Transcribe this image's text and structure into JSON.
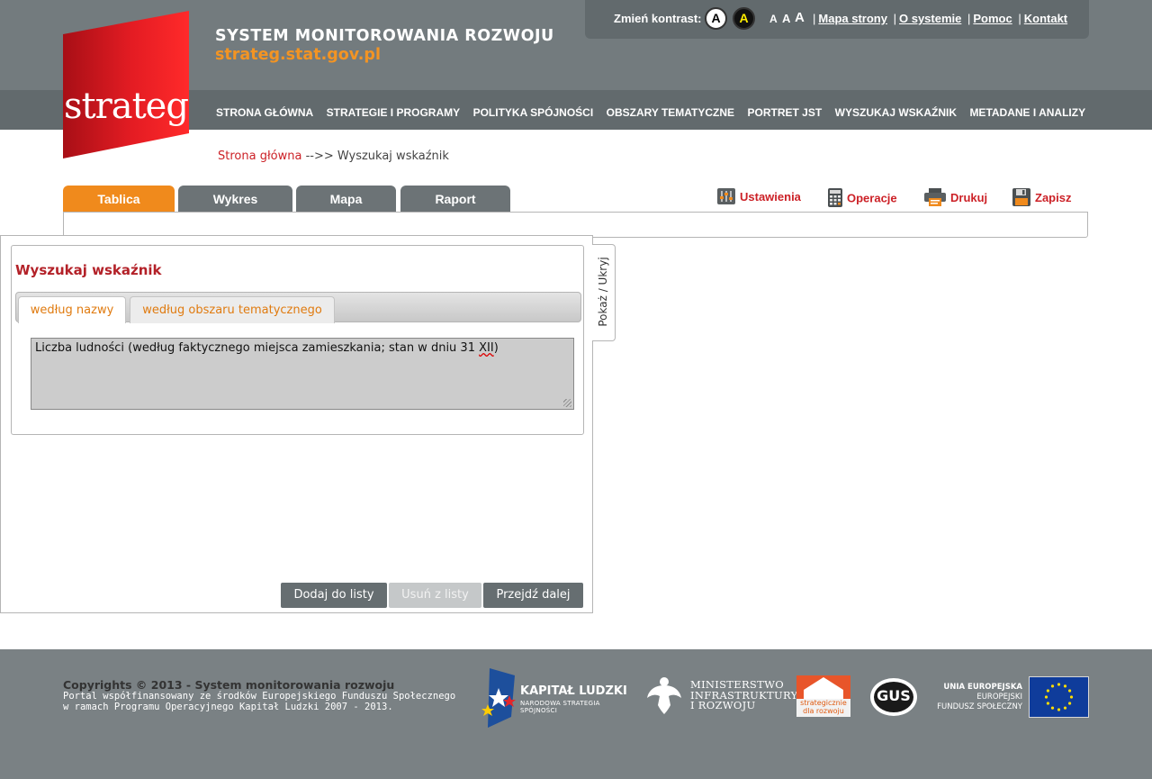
{
  "header": {
    "logo_text": "strateg",
    "title": "SYSTEM MONITOROWANIA ROZWOJU",
    "url": "strateg.stat.gov.pl"
  },
  "toolbar": {
    "contrast_label": "Zmień kontrast:",
    "contrast_options": [
      "A",
      "A"
    ],
    "font_sizes": [
      "A",
      "A",
      "A"
    ],
    "links": [
      "Mapa strony",
      "O systemie",
      "Pomoc",
      "Kontakt"
    ]
  },
  "nav": {
    "items": [
      "STRONA GŁÓWNA",
      "STRATEGIE I PROGRAMY",
      "POLITYKA SPÓJNOŚCI",
      "OBSZARY TEMATYCZNE",
      "PORTRET JST",
      "WYSZUKAJ WSKAŹNIK",
      "METADANE I ANALIZY"
    ]
  },
  "breadcrumb": {
    "home": "Strona główna",
    "separator": "-->>",
    "current": "Wyszukaj wskaźnik"
  },
  "tabs": [
    {
      "label": "Tablica",
      "active": true
    },
    {
      "label": "Wykres",
      "active": false
    },
    {
      "label": "Mapa",
      "active": false
    },
    {
      "label": "Raport",
      "active": false
    }
  ],
  "tools": {
    "settings": "Ustawienia",
    "operations": "Operacje",
    "print": "Drukuj",
    "save": "Zapisz"
  },
  "search": {
    "title": "Wyszukaj wskaźnik",
    "subtabs": [
      "według nazwy",
      "według obszaru tematycznego"
    ],
    "active_subtab": "według nazwy",
    "query_prefix": "Liczba ludności (według faktycznego miejsca zamieszkania; stan w dniu 31 ",
    "query_spell": "XII",
    "query_suffix": ")",
    "toggle_label": "Pokaż / Ukryj"
  },
  "buttons": {
    "add": "Dodaj do listy",
    "remove": "Usuń z listy",
    "next": "Przejdź dalej"
  },
  "footer": {
    "copyright": "Copyrights © 2013 - System monitorowania rozwoju",
    "note_line1": "Portal współfinansowany ze środków Europejskiego Funduszu Społecznego",
    "note_line2": "w ramach Programu Operacyjnego Kapitał Ludzki 2007 - 2013.",
    "kl_title": "KAPITAŁ LUDZKI",
    "kl_sub": "NARODOWA STRATEGIA SPÓJNOŚCI",
    "ministry_line1": "MINISTERSTWO",
    "ministry_line2": "INFRASTRUKTURY",
    "ministry_line3": "I ROZWOJU",
    "strat_line1": "strategicznie",
    "strat_line2": "dla rozwoju",
    "gus": "GUS",
    "eu_line1": "UNIA EUROPEJSKA",
    "eu_line2": "EUROPEJSKI",
    "eu_line3": "FUNDUSZ SPOŁECZNY"
  },
  "colors": {
    "accent_orange": "#f08a1c",
    "brand_red": "#cc2127",
    "header_gray": "#737b7e",
    "nav_gray": "#626a6d"
  }
}
